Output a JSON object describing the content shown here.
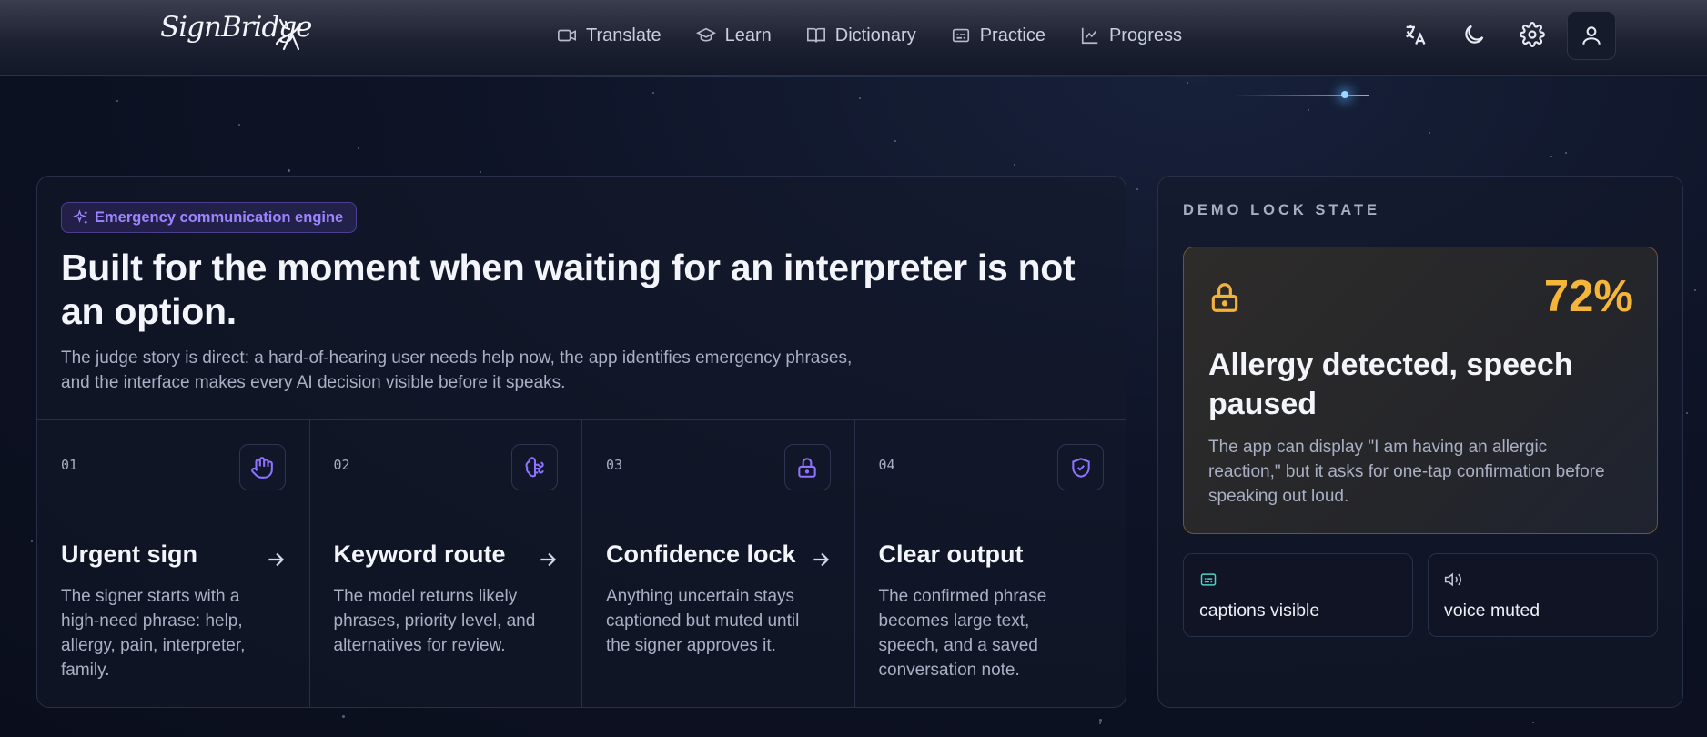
{
  "header": {
    "logo_text": "SignBridge",
    "nav": [
      {
        "label": "Translate",
        "icon": "video-icon"
      },
      {
        "label": "Learn",
        "icon": "graduation-cap-icon"
      },
      {
        "label": "Dictionary",
        "icon": "book-icon"
      },
      {
        "label": "Practice",
        "icon": "captions-icon"
      },
      {
        "label": "Progress",
        "icon": "chart-line-icon"
      }
    ],
    "actions": [
      "language-icon",
      "moon-icon",
      "gear-icon",
      "user-icon"
    ]
  },
  "main": {
    "badge": "Emergency communication engine",
    "headline": "Built for the moment when waiting for an interpreter is not an option.",
    "subtext": "The judge story is direct: a hard-of-hearing user needs help now, the app identifies emergency phrases, and the interface makes every AI decision visible before it speaks.",
    "steps": [
      {
        "num": "01",
        "title": "Urgent sign",
        "desc": "The signer starts with a high-need phrase: help, allergy, pain, interpreter, family.",
        "icon": "hand-icon"
      },
      {
        "num": "02",
        "title": "Keyword route",
        "desc": "The model returns likely phrases, priority level, and alternatives for review.",
        "icon": "brain-icon"
      },
      {
        "num": "03",
        "title": "Confidence lock",
        "desc": "Anything uncertain stays captioned but muted until the signer approves it.",
        "icon": "lock-icon"
      },
      {
        "num": "04",
        "title": "Clear output",
        "desc": "The confirmed phrase becomes large text, speech, and a saved conversation note.",
        "icon": "shield-check-icon"
      }
    ]
  },
  "demo": {
    "label": "DEMO LOCK STATE",
    "percent": "72%",
    "title": "Allergy detected, speech paused",
    "desc": "The app can display \"I am having an allergic reaction,\" but it asks for one-tap confirmation before speaking out loud.",
    "statuses": [
      {
        "label": "captions visible",
        "icon": "captions-icon",
        "color": "#4fd1c5"
      },
      {
        "label": "voice muted",
        "icon": "speaker-icon",
        "color": "#c7ccd9"
      }
    ],
    "accent": "#f5b53a"
  }
}
